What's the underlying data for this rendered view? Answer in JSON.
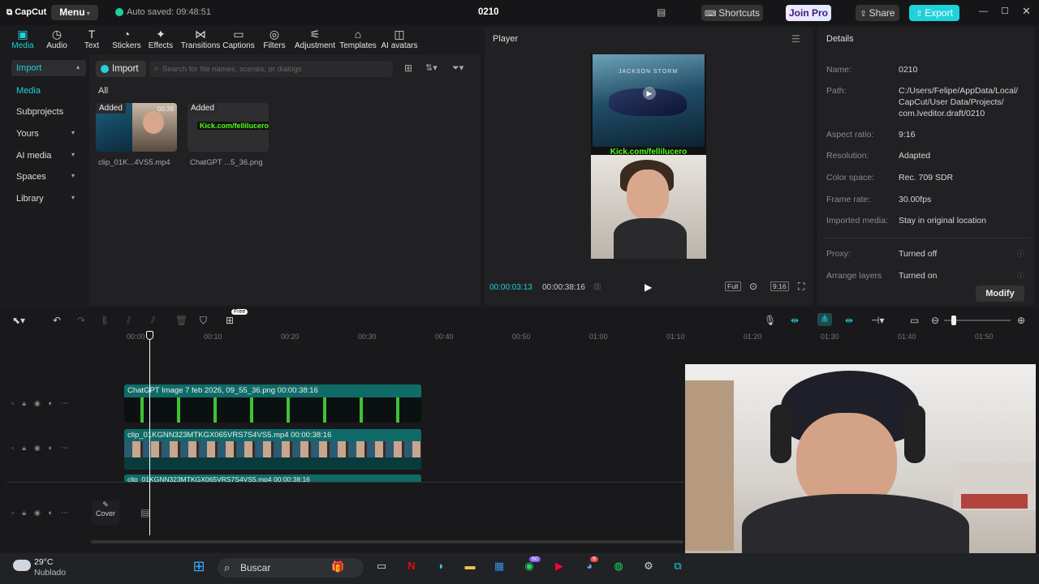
{
  "app": {
    "name": "CapCut",
    "menu_label": "Menu",
    "autosave": "Auto saved: 09:48:51",
    "project_title": "0210",
    "shortcuts_label": "Shortcuts",
    "join_pro_label": "Join Pro",
    "share_label": "Share",
    "export_label": "Export"
  },
  "toolbar": {
    "items": [
      {
        "label": "Media",
        "icon": "media-icon"
      },
      {
        "label": "Audio",
        "icon": "audio-icon"
      },
      {
        "label": "Text",
        "icon": "text-icon"
      },
      {
        "label": "Stickers",
        "icon": "stickers-icon"
      },
      {
        "label": "Effects",
        "icon": "effects-icon"
      },
      {
        "label": "Transitions",
        "icon": "transitions-icon"
      },
      {
        "label": "Captions",
        "icon": "captions-icon"
      },
      {
        "label": "Filters",
        "icon": "filters-icon"
      },
      {
        "label": "Adjustment",
        "icon": "adjustment-icon"
      },
      {
        "label": "Templates",
        "icon": "templates-icon"
      },
      {
        "label": "AI avatars",
        "icon": "ai-avatars-icon"
      }
    ]
  },
  "sidebar": {
    "items": [
      "Import",
      "Media",
      "Subprojects",
      "Yours",
      "AI media",
      "Spaces",
      "Library"
    ]
  },
  "media": {
    "import_label": "Import",
    "search_placeholder": "Search for file names, scenes, or dialogs",
    "filter_all": "All",
    "items": [
      {
        "badge": "Added",
        "name": "clip_01K...4VS5.mp4",
        "duration": "00:39"
      },
      {
        "badge": "Added",
        "name": "ChatGPT ...5_36.png",
        "overlay": "Kick.com/fellilucero"
      }
    ]
  },
  "player": {
    "title": "Player",
    "time_current": "00:00:03:13",
    "time_total": "00:00:38:16",
    "full_label": "Full",
    "ratio_label": "9:16",
    "overlay_text": "JACKSON STORM",
    "kick_text": "Kick.com/fellilucero"
  },
  "details": {
    "title": "Details",
    "rows": [
      {
        "k": "Name:",
        "v": "0210"
      },
      {
        "k": "Path:",
        "v": "C:/Users/Felipe/AppData/Local/ CapCut/User Data/Projects/ com.lveditor.draft/0210"
      },
      {
        "k": "Aspect ratio:",
        "v": "9:16"
      },
      {
        "k": "Resolution:",
        "v": "Adapted"
      },
      {
        "k": "Color space:",
        "v": "Rec. 709 SDR"
      },
      {
        "k": "Frame rate:",
        "v": "30.00fps"
      },
      {
        "k": "Imported media:",
        "v": "Stay in original location"
      },
      {
        "k": "Proxy:",
        "v": "Turned off"
      },
      {
        "k": "Arrange layers",
        "v": "Turned on"
      }
    ],
    "modify_label": "Modify"
  },
  "timeline": {
    "free_badge": "Free",
    "ruler": [
      "00:00",
      "00:10",
      "00:20",
      "00:30",
      "00:40",
      "00:50",
      "01:00",
      "01:10",
      "01:20",
      "01:30",
      "01:40",
      "01:50"
    ],
    "clips": [
      {
        "label": "ChatGPT Image 7 feb 2026, 09_55_36.png   00:00:38:16"
      },
      {
        "label": "clip_01KGNN323MTKGX065VRS7S4VS5.mp4   00:00:38:16"
      },
      {
        "label": "clip_01KGNN323MTKGX065VRS7S4VS5.mp4   00:00:38:16"
      }
    ],
    "cover_label": "Cover"
  },
  "taskbar": {
    "weather_temp": "29°C",
    "weather_desc": "Nublado",
    "search_label": "Buscar",
    "whatsapp_badge": "60",
    "discord_badge": "9"
  },
  "colors": {
    "accent": "#1fd1d8",
    "clip_teal": "#0f6b68",
    "clip_dark": "#083b3c"
  }
}
